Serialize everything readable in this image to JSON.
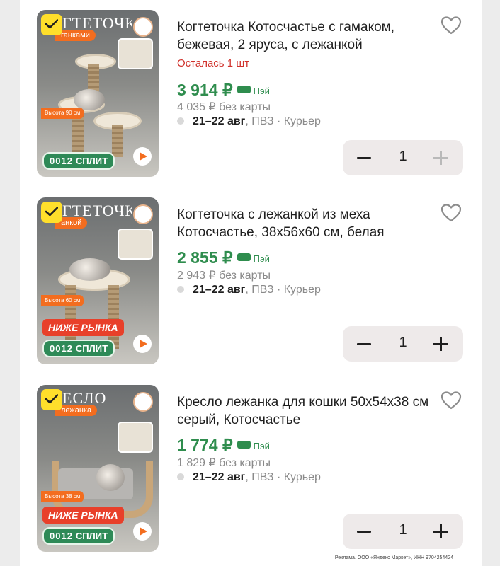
{
  "products": [
    {
      "photo_title": "ГТЕТОЧКА",
      "photo_ribbon": "ганками",
      "photo_height": "Высота 90 см",
      "split_zeros": "0012",
      "split_label": "СПЛИТ",
      "title": "Когтеточка Котосчастье с гамаком, бежевая, 2 яруса, с лежанкой",
      "stock_note": "Осталась 1 шт",
      "price": "3 914 ₽",
      "pay_label": "Пэй",
      "old_price": "4 035 ₽ без карты",
      "delivery_dates": "21–22 авг",
      "delivery_rest": ", ПВЗ · Курьер",
      "quantity": "1"
    },
    {
      "photo_title": "ГТЕТОЧКА",
      "photo_ribbon": "анкой",
      "photo_height": "Высота 60 см",
      "lower_price_badge": "НИЖЕ РЫНКА",
      "split_zeros": "0012",
      "split_label": "СПЛИТ",
      "title": "Когтеточка с лежанкой из меха Котосчастье, 38х56х60 см, белая",
      "price": "2 855 ₽",
      "pay_label": "Пэй",
      "old_price": "2 943 ₽ без карты",
      "delivery_dates": "21–22 авг",
      "delivery_rest": ", ПВЗ · Курьер",
      "quantity": "1"
    },
    {
      "photo_title": "ЕСЛО",
      "photo_ribbon": "лежанка",
      "photo_height": "Высота 38 см",
      "lower_price_badge": "НИЖЕ РЫНКА",
      "split_zeros": "0012",
      "split_label": "СПЛИТ",
      "title": "Кресло лежанка для кошки 50х54х38 см серый, Котосчастье",
      "price": "1 774 ₽",
      "pay_label": "Пэй",
      "old_price": "1 829 ₽ без карты",
      "delivery_dates": "21–22 авг",
      "delivery_rest": ", ПВЗ · Курьер",
      "quantity": "1"
    }
  ],
  "ad_disclaimer": "Реклама. ООО «Яндекс Маркет», ИНН 9704254424",
  "colors": {
    "price_green": "#2f8d4e",
    "stock_red": "#d0312b",
    "check_yellow": "#ffdf2b",
    "badge_orange": "#f36d1f"
  }
}
